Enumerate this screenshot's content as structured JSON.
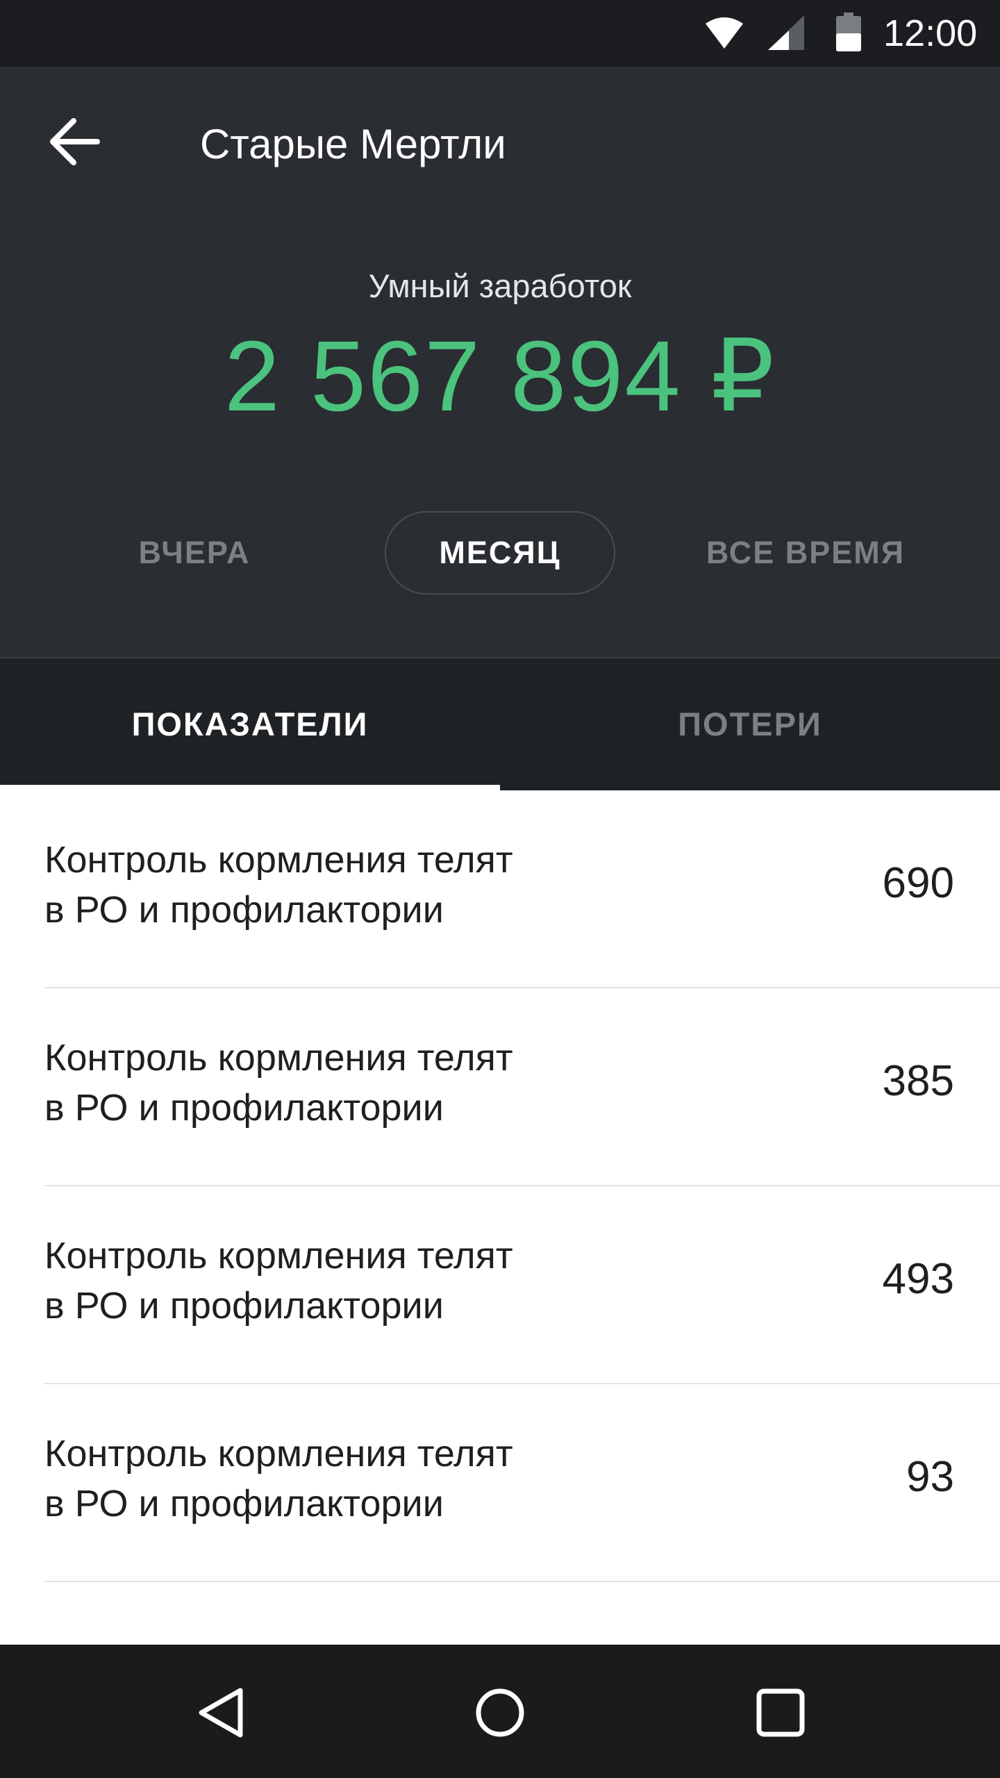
{
  "status_bar": {
    "time": "12:00",
    "icons": [
      "wifi-icon",
      "signal-icon",
      "battery-icon"
    ]
  },
  "header": {
    "back_icon": "arrow-left-icon",
    "title": "Старые Мертли",
    "earnings_label": "Умный заработок",
    "earnings_value": "2 567 894 ₽",
    "periods": [
      {
        "label": "ВЧЕРА",
        "selected": false
      },
      {
        "label": "МЕСЯЦ",
        "selected": true
      },
      {
        "label": "ВСЕ ВРЕМЯ",
        "selected": false
      }
    ]
  },
  "tabs": [
    {
      "label": "ПОКАЗАТЕЛИ",
      "active": true
    },
    {
      "label": "ПОТЕРИ",
      "active": false
    }
  ],
  "list": {
    "items": [
      {
        "label_line1": "Контроль кормления телят",
        "label_line2": "в РО и профилактории",
        "value": "690"
      },
      {
        "label_line1": "Контроль кормления телят",
        "label_line2": "в РО и профилактории",
        "value": "385"
      },
      {
        "label_line1": "Контроль кормления телят",
        "label_line2": "в РО и профилактории",
        "value": "493"
      },
      {
        "label_line1": "Контроль кормления телят",
        "label_line2": "в РО и профилактории",
        "value": "93"
      }
    ]
  },
  "nav_bar": {
    "icons": [
      "nav-back-icon",
      "nav-home-icon",
      "nav-recents-icon"
    ]
  },
  "colors": {
    "accent_green": "#4bc27d",
    "header_bg": "#2a2d31",
    "tabs_bg": "#1f2225",
    "status_bar_bg": "#1b1d20"
  }
}
